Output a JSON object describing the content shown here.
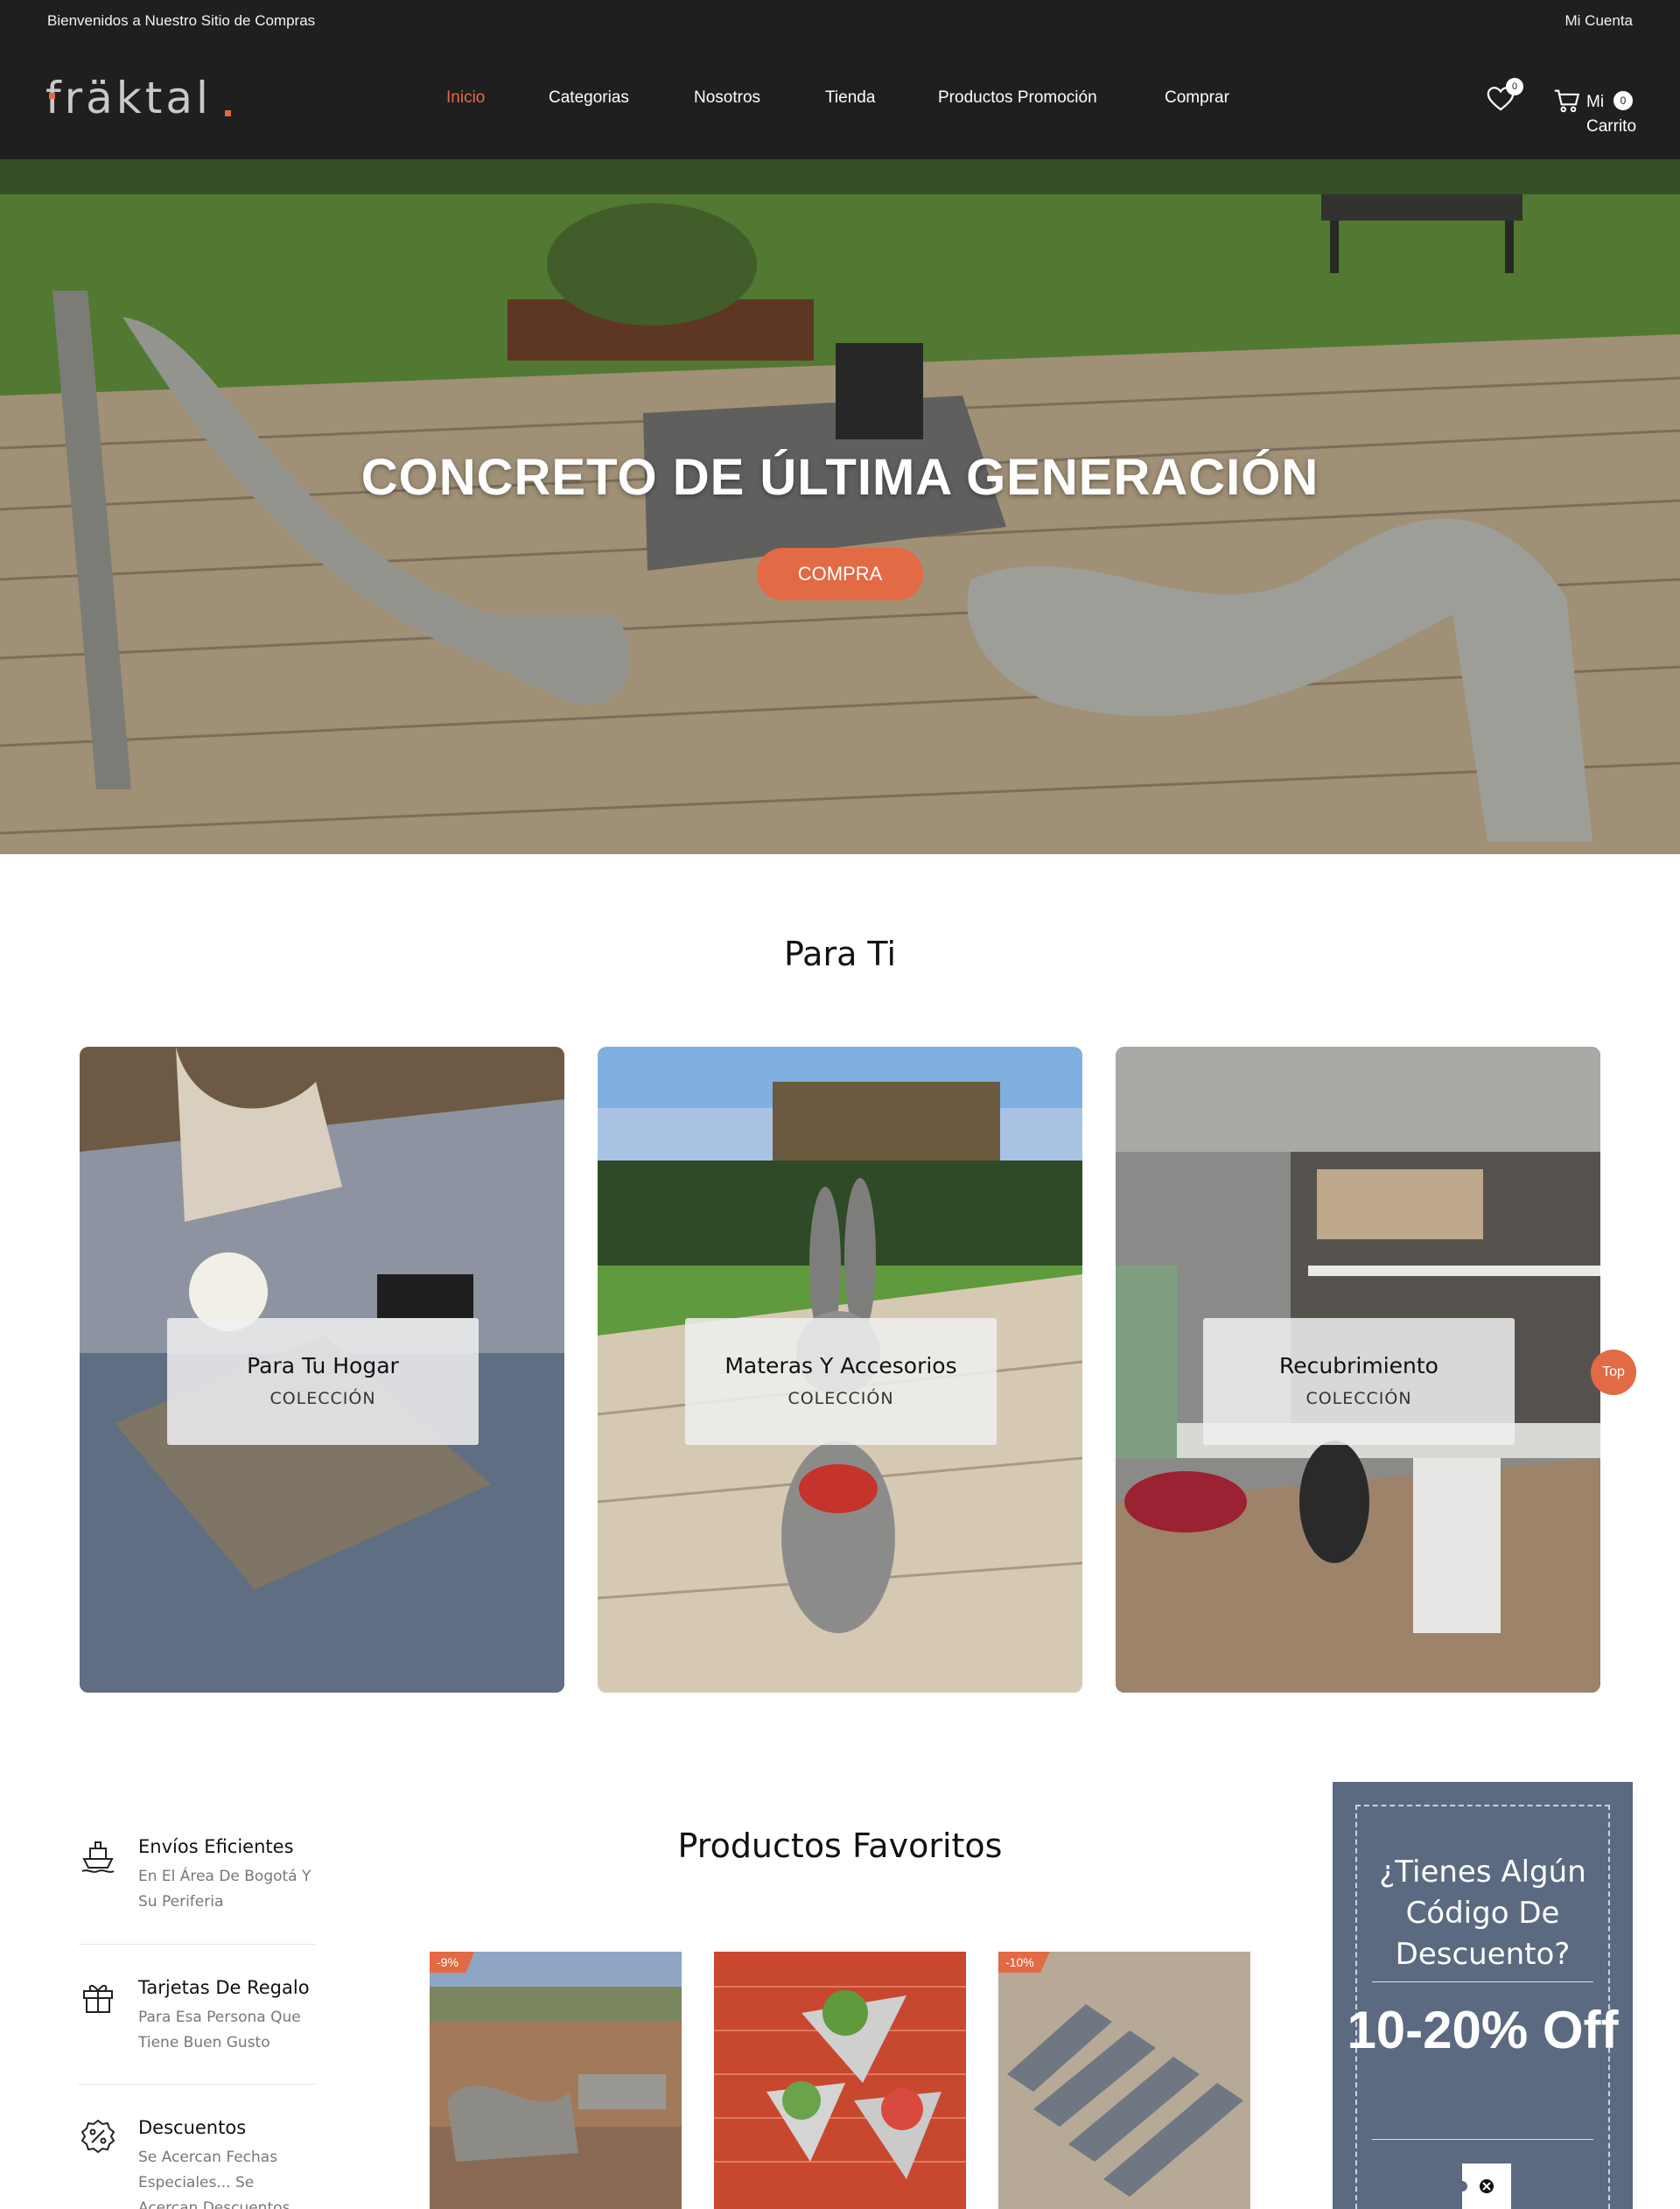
{
  "topbar": {
    "welcome": "Bienvenidos a Nuestro Sitio de Compras",
    "account": "Mi Cuenta"
  },
  "brand": {
    "name": "fräktal",
    "accent": "#e26a44"
  },
  "nav": [
    {
      "label": "Inicio",
      "active": true
    },
    {
      "label": "Categorias"
    },
    {
      "label": "Nosotros"
    },
    {
      "label": "Tienda"
    },
    {
      "label": "Productos Promoción"
    },
    {
      "label": "Comprar"
    }
  ],
  "wishlist": {
    "icon": "heart-icon",
    "count": "0"
  },
  "cart": {
    "icon": "cart-icon",
    "label_line1": "Mi",
    "label_line2": "Carrito",
    "count": "0"
  },
  "hero": {
    "title": "CONCRETO DE ÚLTIMA GENERACIÓN",
    "button": "COMPRA"
  },
  "para_ti": {
    "title": "Para Ti",
    "cards": [
      {
        "title": "Para Tu Hogar",
        "subtitle": "COLECCIÓN"
      },
      {
        "title": "Materas Y Accesorios",
        "subtitle": "COLECCIÓN"
      },
      {
        "title": "Recubrimiento",
        "subtitle": "COLECCIÓN"
      }
    ]
  },
  "top_button": "Top",
  "features": [
    {
      "icon": "ship-icon",
      "title": "Envíos Eficientes",
      "desc": "En El Área De Bogotá Y Su Periferia"
    },
    {
      "icon": "gift-icon",
      "title": "Tarjetas De Regalo",
      "desc": "Para Esa Persona Que Tiene Buen Gusto"
    },
    {
      "icon": "discount-icon",
      "title": "Descuentos",
      "desc": "Se Acercan Fechas Especiales... Se Acercan Descuentos"
    }
  ],
  "favorites": {
    "title": "Productos Favoritos",
    "products": [
      {
        "badge": "-9%"
      },
      {
        "badge": ""
      },
      {
        "badge": "-10%"
      }
    ]
  },
  "promo": {
    "question": "¿Tienes Algún Código De Descuento?",
    "offer": "10-20% Off"
  }
}
